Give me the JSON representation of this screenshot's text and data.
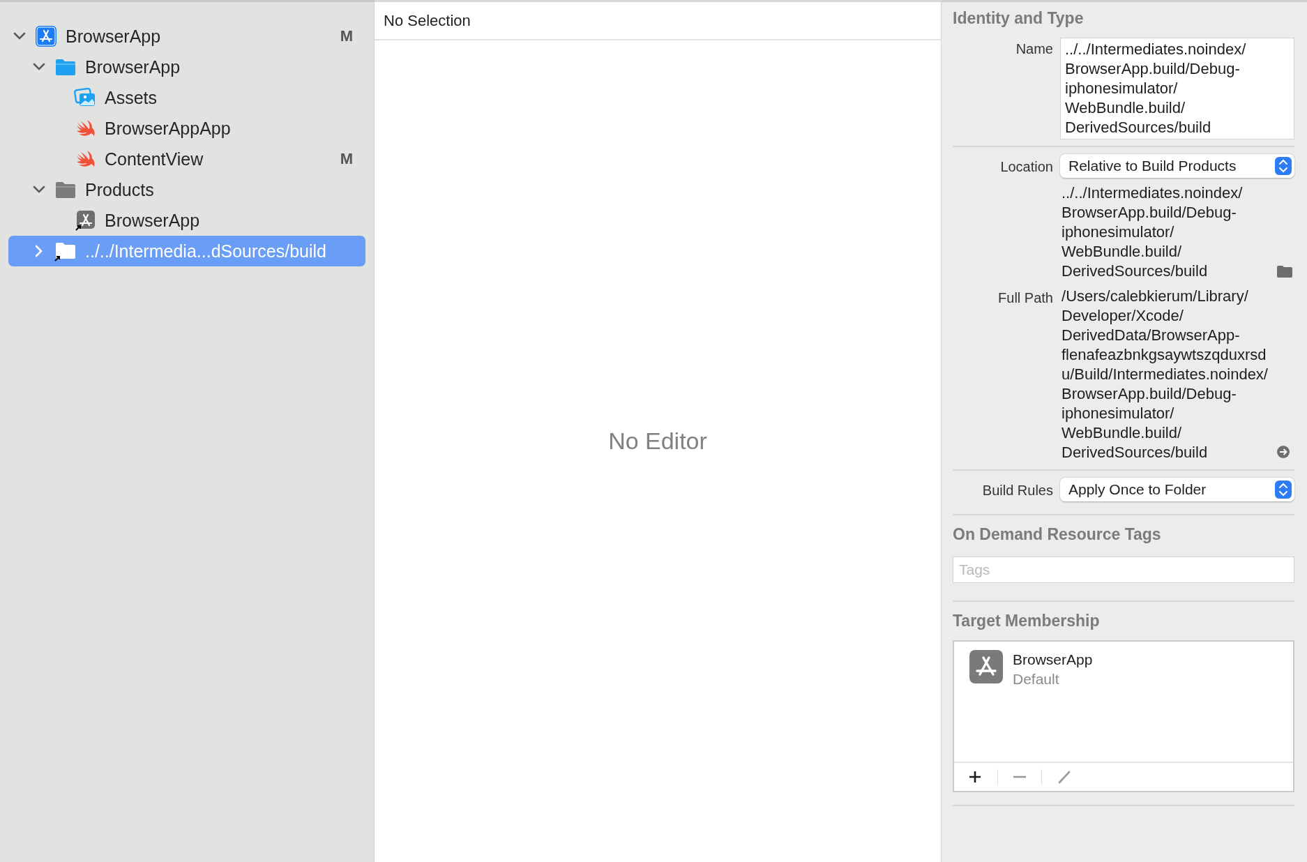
{
  "navigator": {
    "items": [
      {
        "label": "BrowserApp",
        "kind": "project",
        "status": "M",
        "expanded": true,
        "selected": false,
        "children": [
          {
            "label": "BrowserApp",
            "kind": "folder",
            "expanded": true,
            "selected": false,
            "children": [
              {
                "label": "Assets",
                "kind": "assets",
                "selected": false
              },
              {
                "label": "BrowserAppApp",
                "kind": "swift",
                "selected": false
              },
              {
                "label": "ContentView",
                "kind": "swift",
                "status": "M",
                "selected": false
              }
            ]
          },
          {
            "label": "Products",
            "kind": "products",
            "expanded": true,
            "selected": false,
            "children": [
              {
                "label": "BrowserApp",
                "kind": "app",
                "selected": false
              }
            ]
          },
          {
            "label": "../../Intermedia...dSources/build",
            "kind": "folder-link",
            "expanded": false,
            "selected": true
          }
        ]
      }
    ]
  },
  "editor": {
    "header": "No Selection",
    "placeholder": "No Editor"
  },
  "inspector": {
    "identity": {
      "title": "Identity and Type",
      "name_label": "Name",
      "name_value": "../../Intermediates.noindex/BrowserApp.build/Debug-iphonesimulator/WebBundle.build/DerivedSources/build",
      "location_label": "Location",
      "location_value": "Relative to Build Products",
      "location_path": "../../Intermediates.noindex/BrowserApp.build/Debug-iphonesimulator/WebBundle.build/DerivedSources/build",
      "full_path_label": "Full Path",
      "full_path": "/Users/calebkierum/Library/Developer/Xcode/DerivedData/BrowserApp-flenafeazbnkgsaywtszqduxrsdu/Build/Intermediates.noindex/BrowserApp.build/Debug-iphonesimulator/WebBundle.build/DerivedSources/build",
      "build_rules_label": "Build Rules",
      "build_rules_value": "Apply Once to Folder"
    },
    "on_demand": {
      "title": "On Demand Resource Tags",
      "tags_placeholder": "Tags"
    },
    "target_membership": {
      "title": "Target Membership",
      "targets": [
        {
          "name": "BrowserApp",
          "detail": "Default"
        }
      ]
    }
  }
}
